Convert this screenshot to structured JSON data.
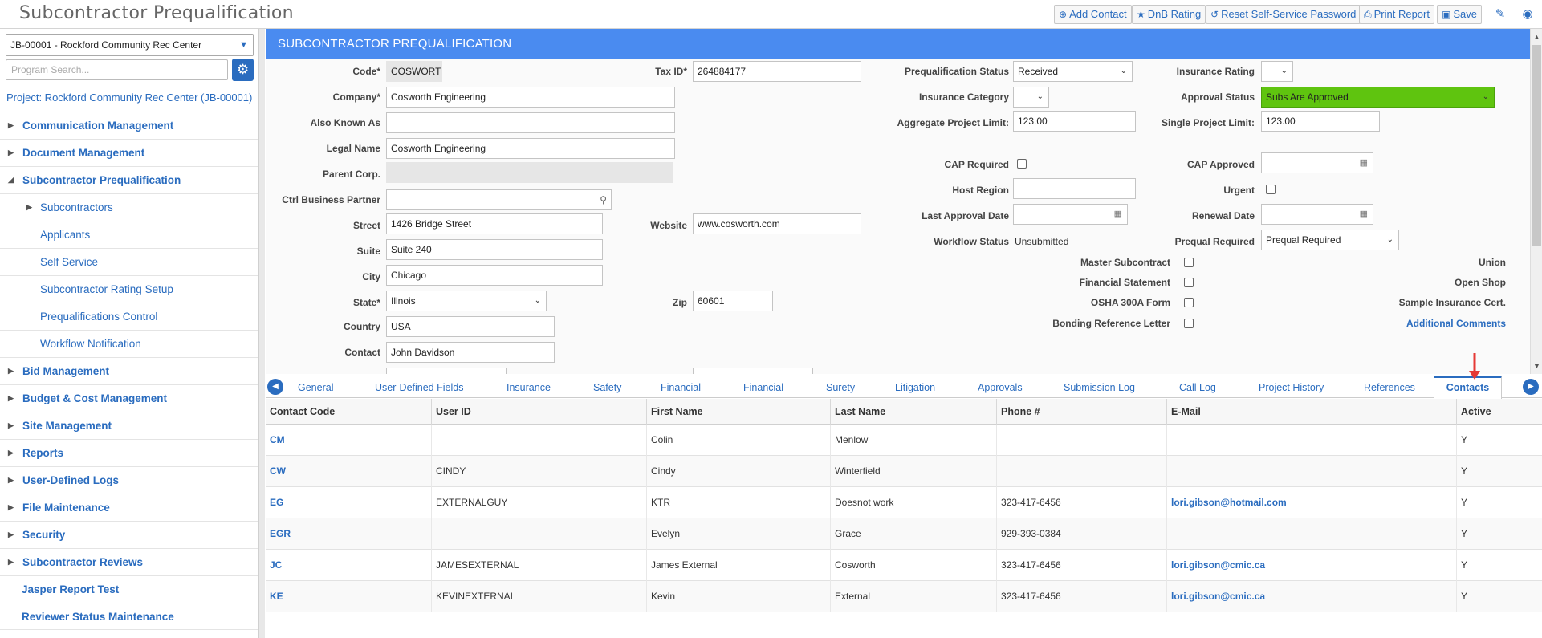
{
  "app": {
    "title": "Subcontractor Prequalification"
  },
  "toolbar": {
    "add_contact": "Add Contact",
    "dnb_rating": "DnB Rating",
    "reset_password": "Reset Self-Service Password",
    "print_report": "Print Report",
    "save": "Save"
  },
  "sidebar": {
    "project_select": "JB-00001 - Rockford Community Rec Center",
    "search_placeholder": "Program Search...",
    "project_link": "Project: Rockford Community Rec Center (JB-00001)",
    "items": [
      {
        "label": "Communication Management",
        "icon": "triangle-right-icon"
      },
      {
        "label": "Document Management",
        "icon": "triangle-right-icon"
      },
      {
        "label": "Subcontractor Prequalification",
        "icon": "triangle-down-icon"
      },
      {
        "label": "Subcontractors",
        "icon": "triangle-right-icon"
      },
      {
        "label": "Applicants"
      },
      {
        "label": "Self Service"
      },
      {
        "label": "Subcontractor Rating Setup"
      },
      {
        "label": "Prequalifications Control"
      },
      {
        "label": "Workflow Notification"
      },
      {
        "label": "Bid Management",
        "icon": "triangle-right-icon"
      },
      {
        "label": "Budget & Cost Management",
        "icon": "triangle-right-icon"
      },
      {
        "label": "Site Management",
        "icon": "triangle-right-icon"
      },
      {
        "label": "Reports",
        "icon": "triangle-right-icon"
      },
      {
        "label": "User-Defined Logs",
        "icon": "triangle-right-icon"
      },
      {
        "label": "File Maintenance",
        "icon": "triangle-right-icon"
      },
      {
        "label": "Security",
        "icon": "triangle-right-icon"
      },
      {
        "label": "Subcontractor Reviews",
        "icon": "triangle-right-icon"
      },
      {
        "label": "Jasper Report Test"
      },
      {
        "label": "Reviewer Status Maintenance"
      }
    ]
  },
  "header": {
    "title": "SUBCONTRACTOR PREQUALIFICATION"
  },
  "form": {
    "code": {
      "label": "Code*",
      "value": "COSWORTH"
    },
    "tax_id": {
      "label": "Tax ID*",
      "value": "264884177"
    },
    "company": {
      "label": "Company*",
      "value": "Cosworth Engineering"
    },
    "aka": {
      "label": "Also Known As",
      "value": ""
    },
    "legal_name": {
      "label": "Legal Name",
      "value": "Cosworth Engineering"
    },
    "parent_corp": {
      "label": "Parent Corp.",
      "value": ""
    },
    "ctrl_bp": {
      "label": "Ctrl Business Partner",
      "value": ""
    },
    "street": {
      "label": "Street",
      "value": "1426 Bridge Street"
    },
    "website": {
      "label": "Website",
      "value": "www.cosworth.com"
    },
    "suite": {
      "label": "Suite",
      "value": "Suite 240"
    },
    "city": {
      "label": "City",
      "value": "Chicago"
    },
    "state": {
      "label": "State*",
      "value": "Illnois"
    },
    "zip": {
      "label": "Zip",
      "value": "60601"
    },
    "country": {
      "label": "Country",
      "value": "USA"
    },
    "contact": {
      "label": "Contact",
      "value": "John Davidson"
    },
    "prequal_status": {
      "label": "Prequalification Status",
      "value": "Received"
    },
    "insurance_rating": {
      "label": "Insurance Rating",
      "value": ""
    },
    "insurance_category": {
      "label": "Insurance Category",
      "value": ""
    },
    "approval_status": {
      "label": "Approval Status",
      "value": "Subs Are Approved",
      "color": "#5fc40f"
    },
    "aggregate_limit": {
      "label": "Aggregate Project Limit:",
      "value": "123.00"
    },
    "single_limit": {
      "label": "Single Project Limit:",
      "value": "123.00"
    },
    "cap_required": {
      "label": "CAP Required",
      "checked": false
    },
    "cap_approved": {
      "label": "CAP Approved",
      "value": ""
    },
    "host_region": {
      "label": "Host Region",
      "value": ""
    },
    "urgent": {
      "label": "Urgent",
      "checked": false
    },
    "last_approval_date": {
      "label": "Last Approval Date",
      "value": ""
    },
    "renewal_date": {
      "label": "Renewal Date",
      "value": ""
    },
    "workflow_status": {
      "label": "Workflow Status",
      "value": "Unsubmitted"
    },
    "prequal_required": {
      "label": "Prequal Required",
      "value": "Prequal Required"
    },
    "master_subcontract": {
      "label": "Master Subcontract",
      "checked": false
    },
    "union": {
      "label": "Union",
      "checked": false
    },
    "financial_statement": {
      "label": "Financial Statement",
      "checked": false
    },
    "open_shop": {
      "label": "Open Shop",
      "checked": true
    },
    "osha_form": {
      "label": "OSHA 300A Form",
      "checked": false
    },
    "sample_insurance": {
      "label": "Sample Insurance Cert.",
      "checked": false
    },
    "bonding_letter": {
      "label": "Bonding Reference Letter",
      "checked": false
    },
    "additional_comments": {
      "label": "Additional Comments",
      "checked": false
    }
  },
  "tabs": [
    "General",
    "User-Defined Fields",
    "Insurance",
    "Safety",
    "Financial",
    "Financial",
    "Surety",
    "Litigation",
    "Approvals",
    "Submission Log",
    "Call Log",
    "Project History",
    "References",
    "Contacts"
  ],
  "active_tab": "Contacts",
  "contacts": {
    "columns": [
      "Contact Code",
      "User ID",
      "First Name",
      "Last Name",
      "Phone #",
      "E-Mail",
      "Active"
    ],
    "rows": [
      [
        "CM",
        "",
        "Colin",
        "Menlow",
        "",
        "",
        "Y"
      ],
      [
        "CW",
        "CINDY",
        "Cindy",
        "Winterfield",
        "",
        "",
        "Y"
      ],
      [
        "EG",
        "EXTERNALGUY",
        "KTR",
        "Doesnot work",
        "323-417-6456",
        "lori.gibson@hotmail.com",
        "Y"
      ],
      [
        "EGR",
        "",
        "Evelyn",
        "Grace",
        "929-393-0384",
        "",
        "Y"
      ],
      [
        "JC",
        "JAMESEXTERNAL",
        "James External",
        "Cosworth",
        "323-417-6456",
        "lori.gibson@cmic.ca",
        "Y"
      ],
      [
        "KE",
        "KEVINEXTERNAL",
        "Kevin",
        "External",
        "323-417-6456",
        "lori.gibson@cmic.ca",
        "Y"
      ]
    ]
  },
  "colors": {
    "accent": "#2a6cbf",
    "header": "#4a8bf0",
    "approved": "#5fc40f",
    "annotation_arrow": "#e53935"
  }
}
